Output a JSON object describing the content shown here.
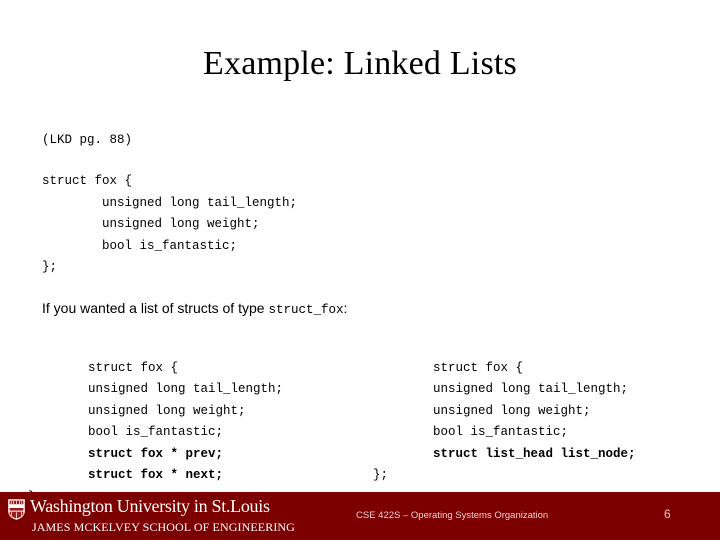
{
  "slide": {
    "title": "Example: Linked Lists",
    "reference": "(LKD pg. 88)",
    "struct_definition": "struct fox {\n        unsigned long tail_length;\n        unsigned long weight;\n        bool is_fantastic;\n};",
    "prose": {
      "before": "If you wanted a list of structs of type ",
      "mono_term": "struct_fox",
      "after": ":"
    },
    "code_left": {
      "lines_plain_head": "struct fox {\n        unsigned long tail_length;\n        unsigned long weight;\n        bool is_fantastic;\n",
      "lines_bold": "        struct fox * prev;\n        struct fox * next;",
      "lines_plain_tail": "\n};"
    },
    "code_right": {
      "lines_plain_head": "struct fox {\n        unsigned long tail_length;\n        unsigned long weight;\n        bool is_fantastic;\n",
      "lines_bold": "        struct list_head list_node;",
      "lines_plain_tail": "\n};"
    }
  },
  "footer": {
    "university": "Washington University in St.Louis",
    "school": "JAMES MCKELVEY SCHOOL OF ENGINEERING",
    "course": "CSE 422S – Operating Systems Organization",
    "page_number": "6",
    "band_color": "#7d0000",
    "text_color": "#f0cccc"
  }
}
